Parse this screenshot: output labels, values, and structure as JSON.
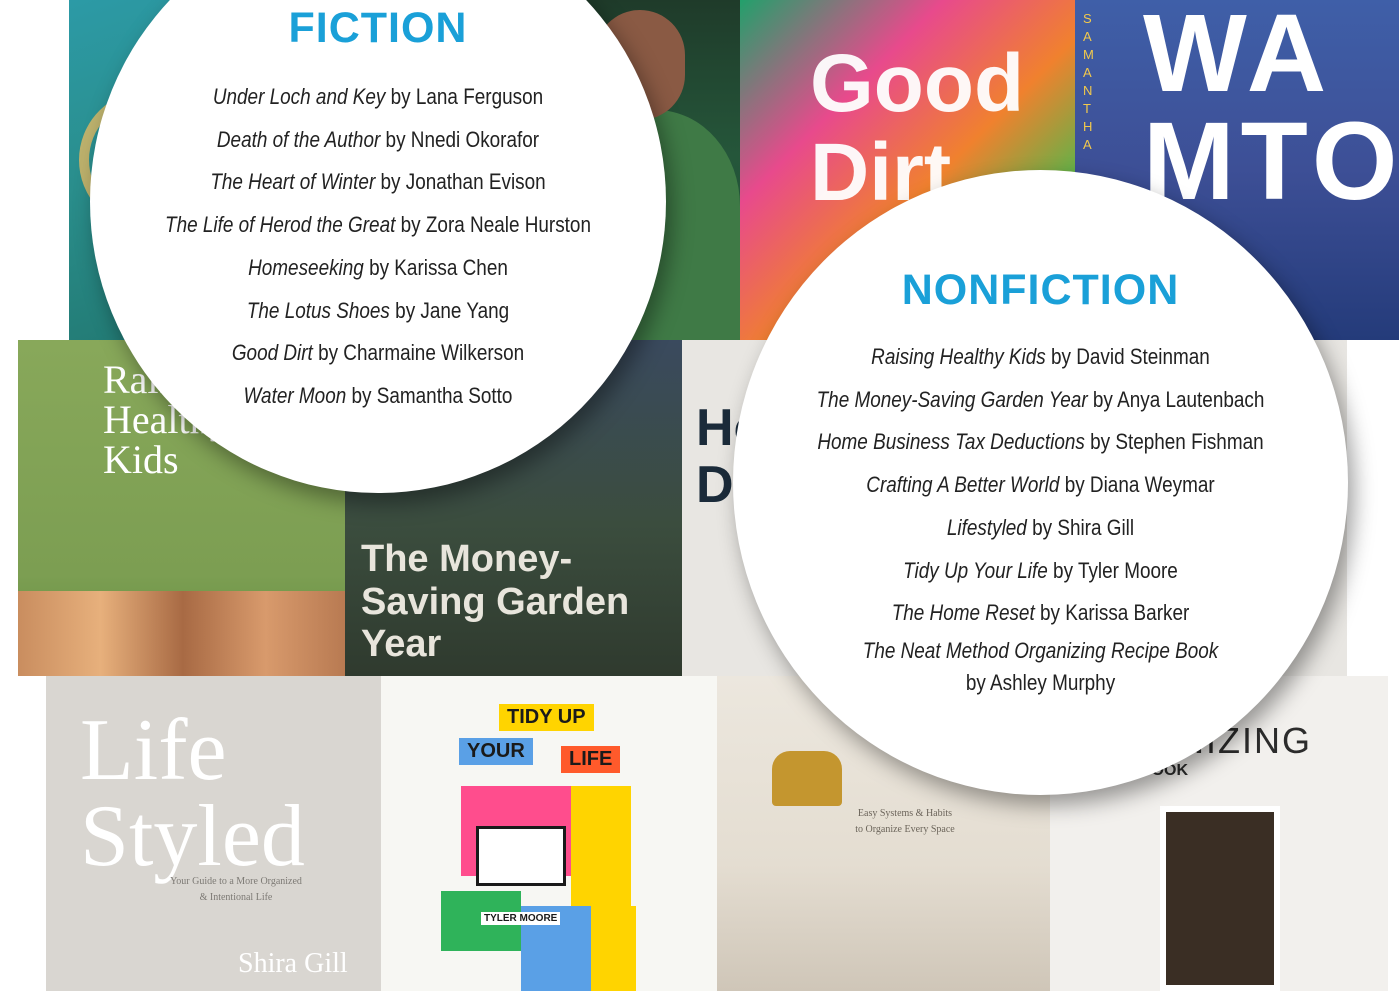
{
  "covers": {
    "good_dirt_title": "Good Dirt",
    "water_moon_title": "WA MTO",
    "water_moon_side": "SAMANTHA",
    "raising_title": "Raising Healthy Kids",
    "money_saving_title": "The Money-Saving Garden Year",
    "home_business_title": "Ho D",
    "lifestyled_title": "Life Styled",
    "lifestyled_subtitle": "Your Guide to a More Organized & Intentional Life",
    "lifestyled_author": "Shira Gill",
    "tidy_line1": "TIDY UP",
    "tidy_line2": "YOUR",
    "tidy_line3": "LIFE",
    "tidy_author": "TYLER MOORE",
    "home_reset_subtitle": "Easy Systems & Habits to Organize Every Space",
    "neat_title": "NIZING",
    "neat_book": "BOOK"
  },
  "fiction": {
    "heading": "FICTION",
    "books": [
      {
        "title": "Under Loch and Key",
        "author": "by Lana Ferguson"
      },
      {
        "title": "Death of the Author",
        "author": "by Nnedi Okorafor"
      },
      {
        "title": "The Heart of Winter",
        "author": "by Jonathan Evison"
      },
      {
        "title": "The Life of Herod the Great",
        "author": "by Zora Neale Hurston"
      },
      {
        "title": "Homeseeking",
        "author": "by Karissa Chen"
      },
      {
        "title": "The Lotus Shoes",
        "author": "by Jane Yang"
      },
      {
        "title": "Good Dirt",
        "author": "by Charmaine Wilkerson"
      },
      {
        "title": "Water Moon",
        "author": "by Samantha Sotto"
      }
    ]
  },
  "nonfiction": {
    "heading": "NONFICTION",
    "books": [
      {
        "title": "Raising Healthy Kids",
        "author": "by David Steinman"
      },
      {
        "title": "The Money-Saving Garden Year",
        "author": "by Anya Lautenbach"
      },
      {
        "title": "Home Business Tax Deductions",
        "author": "by Stephen Fishman"
      },
      {
        "title": "Crafting A Better World",
        "author": "by Diana Weymar"
      },
      {
        "title": "Lifestyled",
        "author": "by Shira Gill"
      },
      {
        "title": "Tidy Up Your Life",
        "author": "by Tyler Moore"
      },
      {
        "title": "The Home Reset",
        "author": "by Karissa Barker"
      },
      {
        "title": "The Neat Method Organizing Recipe Book",
        "author": "by Ashley Murphy"
      }
    ]
  },
  "colors": {
    "heading_blue": "#1aa0d8",
    "text": "#222222",
    "circle": "#ffffff"
  }
}
